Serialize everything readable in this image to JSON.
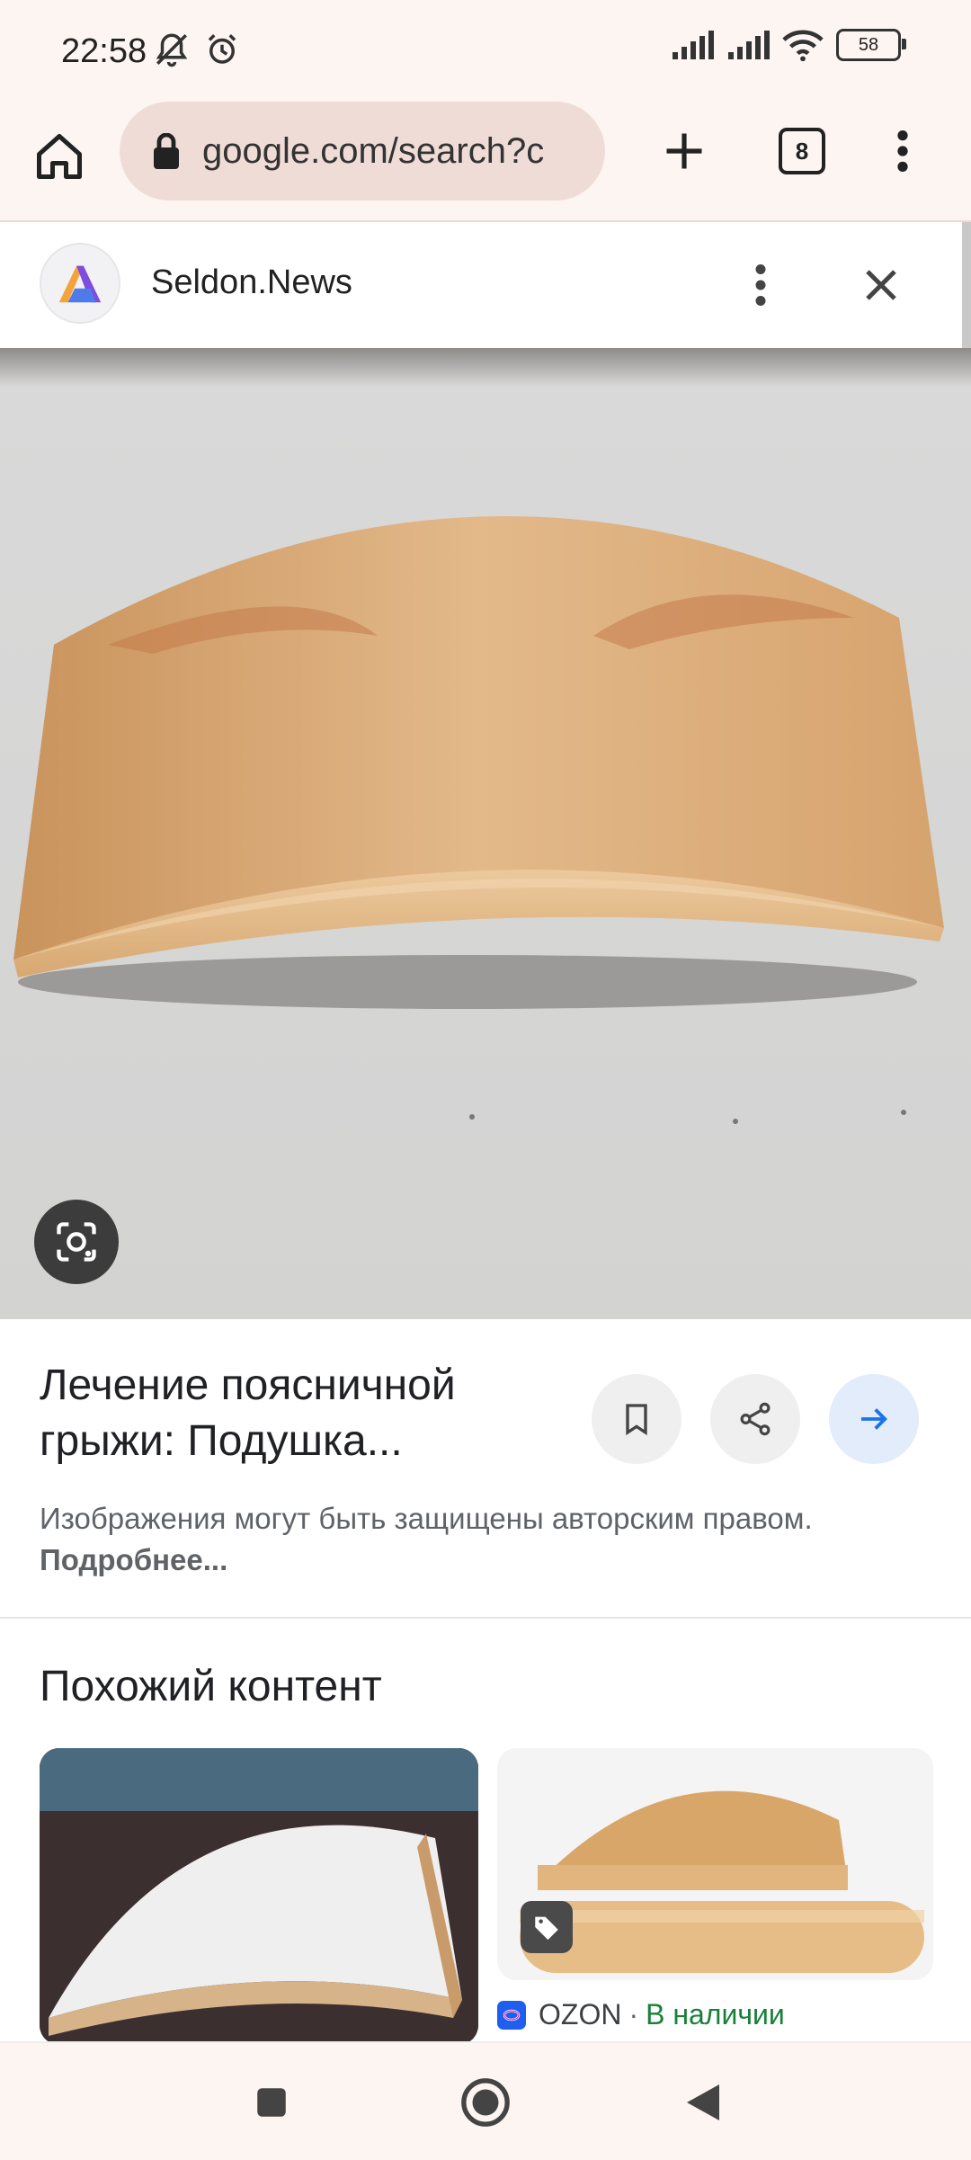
{
  "status_bar": {
    "time": "22:58",
    "battery": "58",
    "icons": [
      "muted-notifications-icon",
      "alarm-icon",
      "signal-icon",
      "signal-icon",
      "wifi-icon",
      "battery-icon"
    ]
  },
  "browser": {
    "url": "google.com/search?c",
    "tab_count": "8"
  },
  "source": {
    "name": "Seldon.News"
  },
  "result": {
    "title": "Лечение поясничной грыжи: Подушка...",
    "copyright_text": "Изображения могут быть защищены авторским правом.",
    "copyright_link": "Подробнее..."
  },
  "related": {
    "heading": "Похожий контент",
    "items": [
      {
        "image": "white wooden arc board"
      },
      {
        "image": "wooden arc board and roller",
        "source": "OZON",
        "availability": "В наличии"
      }
    ]
  },
  "colors": {
    "chrome_bg": "#fdf5f2",
    "url_bar": "#f0dcd6",
    "accent_blue": "#1a73e8",
    "in_stock_green": "#188038"
  }
}
